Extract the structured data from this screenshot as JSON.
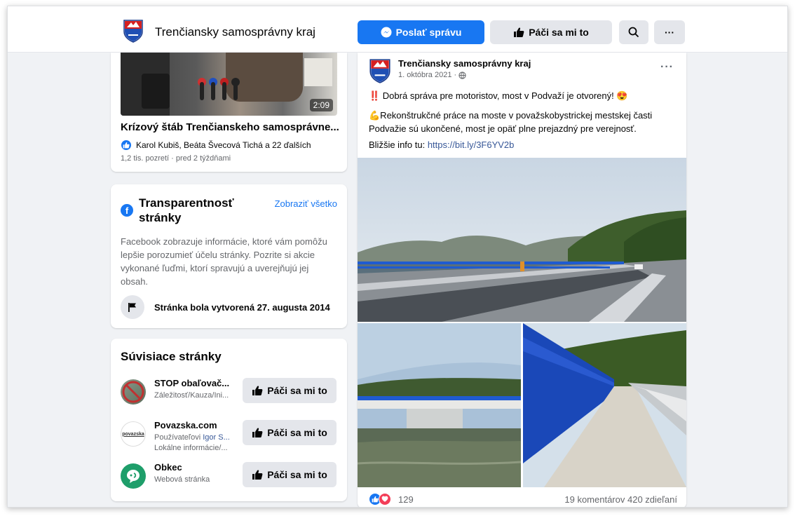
{
  "header": {
    "page_name": "Trenčiansky samosprávny kraj",
    "message_button": "Poslať správu",
    "like_button": "Páči sa mi to",
    "more_label": "···"
  },
  "video": {
    "duration": "2:09",
    "title": "Krízový štáb Trenčianskeho samosprávne...",
    "reactors": "Karol Kubiš, Beáta Švecová Tichá a 22 ďalších",
    "meta": "1,2 tis. pozretí · pred 2 týždňami"
  },
  "transparency": {
    "title": "Transparentnosť stránky",
    "see_all": "Zobraziť všetko",
    "text": "Facebook zobrazuje informácie, ktoré vám pomôžu lepšie porozumieť účelu stránky. Pozrite si akcie vykonané ľuďmi, ktorí spravujú a uverejňujú jej obsah.",
    "created": "Stránka bola vytvorená 27. augusta 2014"
  },
  "related": {
    "title": "Súvisiace stránky",
    "like_label": "Páči sa mi to",
    "items": [
      {
        "name": "STOP obaľovač...",
        "sub": "Záležitosť/Kauza/Ini..."
      },
      {
        "name": "Povazska.com",
        "sub_prefix": "Používateľovi ",
        "sub_link": "Igor S...",
        "sub2": "Lokálne informácie/..."
      },
      {
        "name": "Obkec",
        "sub": "Webová stránka"
      }
    ]
  },
  "post": {
    "author": "Trenčiansky samosprávny kraj",
    "date": "1. októbra 2021 ·",
    "line1": "‼️ Dobrá správa pre motoristov, most v Podvaží je otvorený! 😍",
    "line2": "💪Rekonštrukčné práce na moste v považskobystrickej mestskej časti Podvažie sú ukončené, most je opäť plne prejazdný pre verejnosť.",
    "line3_prefix": "Bližšie info tu: ",
    "link": "https://bit.ly/3F6YV2b",
    "reaction_count": "129",
    "stats": "19 komentárov  420 zdieľaní",
    "more_label": "···"
  },
  "colors": {
    "accent": "#1877f2",
    "background": "#f0f2f5",
    "secondary_button": "#e4e6eb",
    "love": "#f33e58"
  }
}
